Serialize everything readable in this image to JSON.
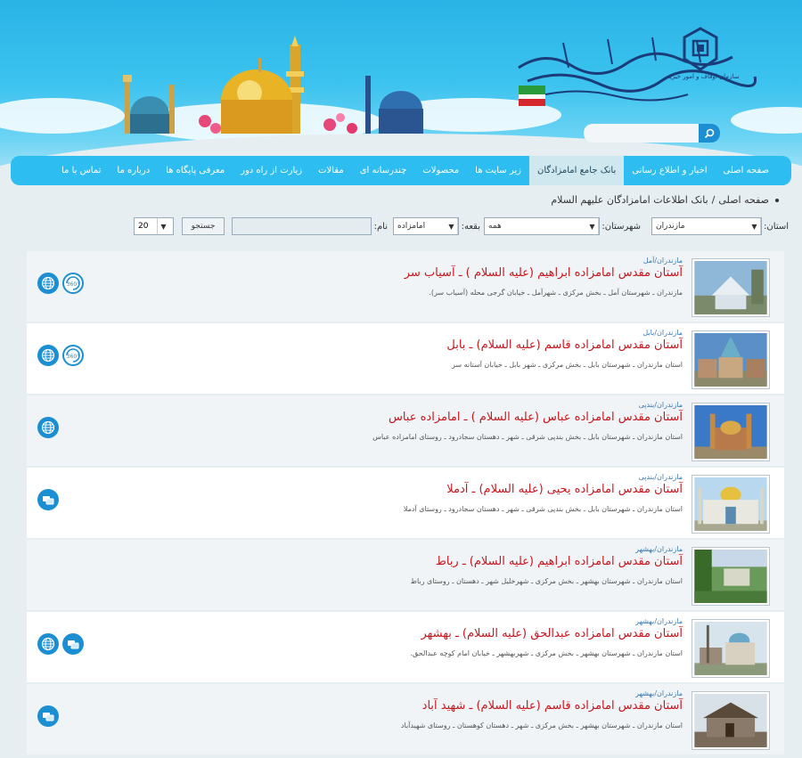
{
  "header": {
    "logo_small_text": "سازمان اوقاف و امور خیریه",
    "search": {
      "placeholder": ""
    }
  },
  "nav": {
    "items": [
      {
        "label": "صفحه اصلی",
        "active": false
      },
      {
        "label": "اخبار و اطلاع رسانی",
        "active": false
      },
      {
        "label": "بانک جامع امامزادگان",
        "active": true
      },
      {
        "label": "زیر سایت ها",
        "active": false
      },
      {
        "label": "محصولات",
        "active": false
      },
      {
        "label": "چندرسانه ای",
        "active": false
      },
      {
        "label": "مقالات",
        "active": false
      },
      {
        "label": "زیارت از راه دور",
        "active": false
      },
      {
        "label": "معرفی پایگاه ها",
        "active": false
      },
      {
        "label": "درباره ما",
        "active": false
      },
      {
        "label": "تماس با ما",
        "active": false
      }
    ]
  },
  "breadcrumb": {
    "home": "صفحه اصلی",
    "separator": "/",
    "current": "بانک اطلاعات امامزادگان علیهم السلام"
  },
  "filters": {
    "province_label": "استان:",
    "province_value": "مازندران",
    "city_label": "شهرستان:",
    "city_value": "همه",
    "type_label": "بقعه:",
    "type_value": "امامزاده",
    "name_label": "نام:",
    "name_value": "",
    "search_label": "جستجو",
    "page_size": "20"
  },
  "results": [
    {
      "location": "مازندران/آمل",
      "title": "آستان مقدس امامزاده ابراهیم (علیه السلام ) ـ آسیاب سر",
      "address": "مازندران ـ شهرستان آمل ـ بخش مرکزی ـ شهرآمل ـ خیابان گرجی محله (آسیاب سر).",
      "icons": [
        "globe-icon",
        "360-view-icon"
      ]
    },
    {
      "location": "مازندران/بابل",
      "title": "آستان مقدس امامزاده قاسم (علیه السلام) ـ بابل",
      "address": "استان مازندران ـ شهرستان بابل ـ بخش مرکزی ـ شهر بابل ـ خیابان آستانه سر",
      "icons": [
        "globe-icon",
        "360-view-icon"
      ]
    },
    {
      "location": "مازندران/بندپی",
      "title": "آستان مقدس امامزاده عباس (علیه السلام ) ـ امامزاده عباس",
      "address": "استان مازندران ـ شهرستان بابل ـ بخش بندپی شرقی ـ شهر ـ دهستان سجادرود ـ روستای امامزاده عباس",
      "icons": [
        "globe-icon"
      ]
    },
    {
      "location": "مازندران/بندپی",
      "title": "آستان مقدس امامزاده یحیی (علیه السلام) ـ آدملا",
      "address": "استان مازندران ـ شهرستان بابل ـ بخش بندپی شرقی ـ شهر ـ دهستان سجادرود ـ روستای آدملا",
      "icons": [
        "gallery-icon"
      ]
    },
    {
      "location": "مازندران/بهشهر",
      "title": "آستان مقدس امامزاده ابراهیم (علیه السلام) ـ رباط",
      "address": "استان مازندران ـ شهرستان بهشهر ـ بخش مرکزی ـ شهرخلیل شهر ـ دهستان ـ روستای رباط",
      "icons": []
    },
    {
      "location": "مازندران/بهشهر",
      "title": "آستان مقدس امامزاده عبدالحق (علیه السلام) ـ بهشهر",
      "address": "استان مازندران ـ شهرستان بهشهر ـ بخش مرکزی ـ شهربهشهر ـ خیابان امام کوچه عبدالحق.",
      "icons": [
        "globe-icon",
        "gallery-icon"
      ]
    },
    {
      "location": "مازندران/بهشهر",
      "title": "آستان مقدس امامزاده قاسم (علیه السلام) ـ شهید آباد",
      "address": "استان مازندران ـ شهرستان بهشهر ـ بخش مرکزی ـ شهر ـ دهستان کوهستان ـ روستای شهیدآباد",
      "icons": [
        "gallery-icon"
      ]
    }
  ],
  "colors": {
    "nav_bg": "#2ebdf0",
    "nav_active_bg": "#cfe7ef",
    "title_red": "#c8161d",
    "location_blue": "#3778b4",
    "icon_blue": "#1b8fd2"
  }
}
